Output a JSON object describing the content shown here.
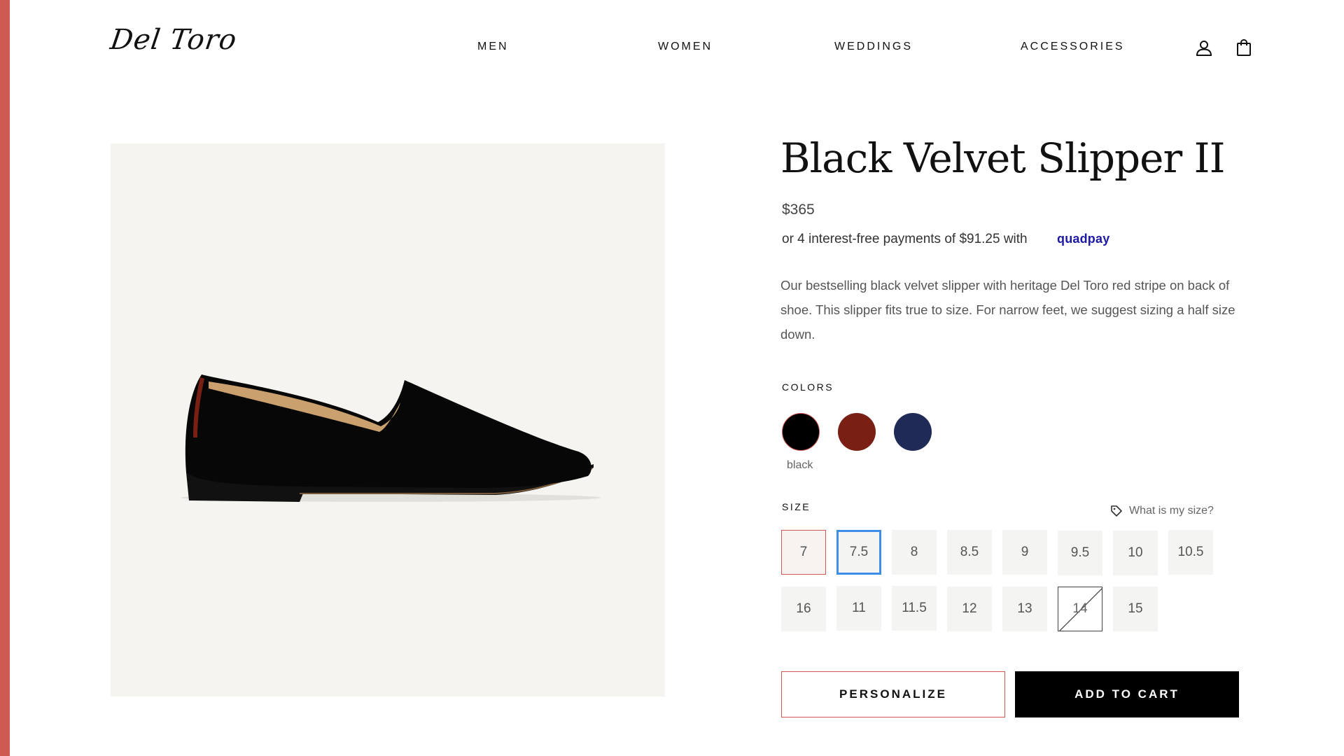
{
  "brand": {
    "logo_text": "Del Toro",
    "accent_color": "#cf5a52"
  },
  "nav": {
    "items": [
      {
        "label": "MEN"
      },
      {
        "label": "WOMEN"
      },
      {
        "label": "WEDDINGS"
      },
      {
        "label": "ACCESSORIES"
      }
    ],
    "icons": [
      "account-icon",
      "shopping-bag-icon"
    ]
  },
  "product": {
    "title": "Black Velvet Slipper II",
    "price": "$365",
    "installment_text": "or 4 interest-free payments of $91.25 with",
    "installment_provider": "quadpay",
    "description": "Our bestselling black velvet slipper with heritage Del Toro red stripe on back of shoe. This slipper fits true to size. For narrow feet, we suggest sizing a half size down.",
    "colors_label": "COLORS",
    "colors": [
      {
        "name": "black",
        "hex": "#000000",
        "selected": true
      },
      {
        "name": "burgundy",
        "hex": "#7a1f14",
        "selected": false
      },
      {
        "name": "navy",
        "hex": "#1f2b56",
        "selected": false
      }
    ],
    "selected_color_caption": "black",
    "size_label": "SIZE",
    "size_help": "What is my size?",
    "sizes_row1": [
      "7",
      "7.5",
      "8",
      "8.5",
      "9",
      "9.5",
      "10",
      "10.5"
    ],
    "sizes_row2": [
      "16",
      "11",
      "11.5",
      "12",
      "13",
      "14",
      "15"
    ],
    "unavailable_sizes": [
      "14"
    ],
    "personalize_label": "PERSONALIZE",
    "add_to_cart_label": "ADD TO CART"
  }
}
